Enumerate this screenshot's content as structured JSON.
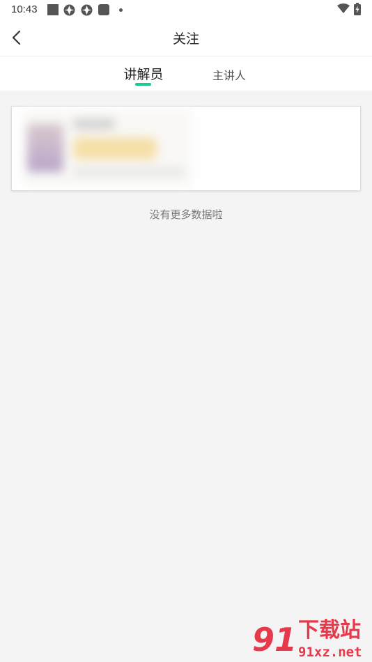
{
  "status_bar": {
    "time": "10:43",
    "left_icons": [
      "square-notification-icon",
      "aperture-icon",
      "aperture-icon",
      "rounded-square-icon",
      "dot-icon"
    ],
    "right_icons": [
      "wifi-icon",
      "battery-charging-icon"
    ]
  },
  "navbar": {
    "title": "关注",
    "back_icon": "chevron-left-icon"
  },
  "tabs": [
    {
      "label": "讲解员",
      "active": true
    },
    {
      "label": "主讲人",
      "active": false
    }
  ],
  "accent_color": "#1ec98c",
  "list": {
    "end_text": "没有更多数据啦"
  },
  "watermark": {
    "logo": "91",
    "title": "下载站",
    "domain": "91xz.net",
    "color": "#e63a4c"
  }
}
